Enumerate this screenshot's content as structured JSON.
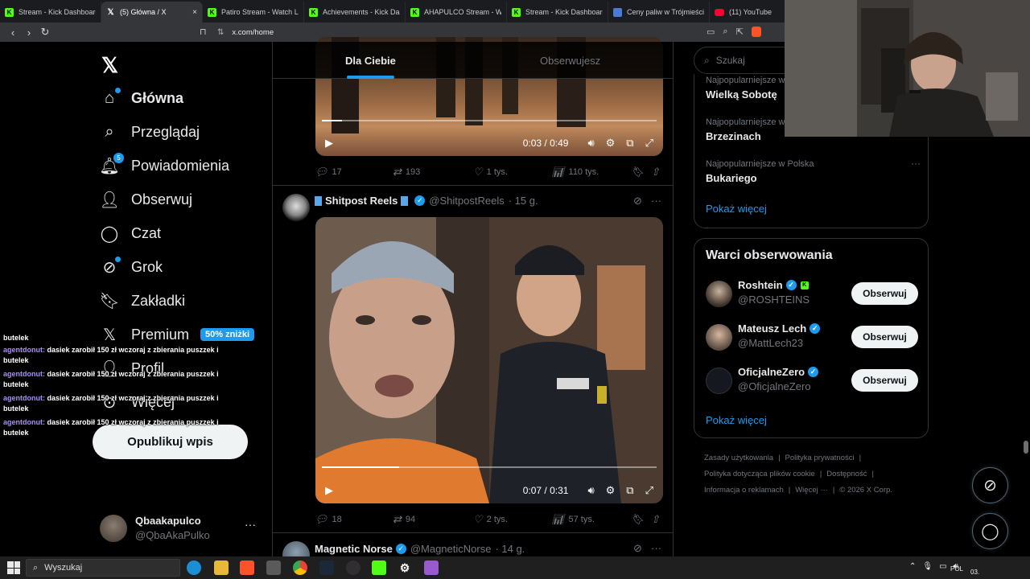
{
  "browser": {
    "tabs": [
      {
        "title": "Stream - Kick Dashboard",
        "icon": "kick-icon",
        "active": false
      },
      {
        "title": "(5) Główna / X",
        "icon": "x-icon",
        "active": true
      },
      {
        "title": "Patiro Stream - Watch Live",
        "icon": "kick-icon",
        "active": false
      },
      {
        "title": "Achievements - Kick Dash",
        "icon": "kick-icon",
        "active": false
      },
      {
        "title": "AHAPULCO Stream - Watc",
        "icon": "kick-icon",
        "active": false
      },
      {
        "title": "Stream - Kick Dashboard",
        "icon": "kick-icon",
        "active": false
      },
      {
        "title": "Ceny paliw w Trójmieście",
        "icon": "page-icon",
        "active": false
      },
      {
        "title": "(11) YouTube",
        "icon": "youtube-icon",
        "active": false
      }
    ],
    "tab_close": "×",
    "url": "x.com/home",
    "nav": {
      "back": "‹",
      "forward": "›",
      "reload": "↻"
    },
    "tune_glyph": "⇅",
    "bookmark_glyph": "⊓"
  },
  "sidebar": {
    "logo": "𝕏",
    "items": [
      {
        "label": "Główna",
        "icon": "home-icon",
        "glyph": "⌂",
        "active": true
      },
      {
        "label": "Przeglądaj",
        "icon": "search-icon",
        "glyph": "⌕"
      },
      {
        "label": "Powiadomienia",
        "icon": "bell-icon",
        "glyph": "🔔︎",
        "badge": "5"
      },
      {
        "label": "Obserwuj",
        "icon": "follow-icon",
        "glyph": "👤︎"
      },
      {
        "label": "Czat",
        "icon": "chat-icon",
        "glyph": "◯"
      },
      {
        "label": "Grok",
        "icon": "grok-icon",
        "glyph": "⊘"
      },
      {
        "label": "Zakładki",
        "icon": "bookmark-icon",
        "glyph": "🔖︎"
      },
      {
        "label": "Premium",
        "icon": "x-premium-icon",
        "glyph": "𝕏",
        "promo": "50% zniżki"
      },
      {
        "label": "Profil",
        "icon": "profile-icon",
        "glyph": "👤︎"
      },
      {
        "label": "Więcej",
        "icon": "more-icon",
        "glyph": "⊙"
      }
    ],
    "post_button": "Opublikuj wpis",
    "account": {
      "name": "Qbaakapulco",
      "handle": "@QbaAkaPulko",
      "more": "···"
    }
  },
  "chat_overlay": {
    "top_fragment": "butelek",
    "messages": [
      {
        "user": "agentdonut:",
        "text": "dasiek zarobił 150 zł wczoraj z zbierania puszzek i butelek"
      },
      {
        "user": "agentdonut:",
        "text": "dasiek zarobił 150 zł wczoraj z zbierania puszzek i butelek"
      },
      {
        "user": "agentdonut:",
        "text": "dasiek zarobił 150 zł wczoraj z zbierania puszzek i butelek"
      },
      {
        "user": "agentdonut:",
        "text": "dasiek zarobił 150 zł wczoraj z zbierania puszzek i butelek"
      }
    ]
  },
  "feed": {
    "tabs": {
      "for_you": "Dla Ciebie",
      "following": "Obserwujesz"
    },
    "tweets": [
      {
        "video": {
          "time": "0:03 / 0:49",
          "progress": 0.06
        },
        "stats": {
          "replies": "17",
          "reposts": "193",
          "likes": "1 tys.",
          "views": "110 tys."
        }
      },
      {
        "author": "Shitpost Reels",
        "handle": "@ShitpostReels",
        "age": "· 15 g.",
        "verified": "✓",
        "video": {
          "time": "0:07 / 0:31",
          "progress": 0.23
        },
        "stats": {
          "replies": "18",
          "reposts": "94",
          "likes": "2 tys.",
          "views": "57 tys."
        }
      },
      {
        "author": "Magnetic Norse",
        "handle": "@MagneticNorse",
        "age": "· 14 g.",
        "verified": "✓"
      }
    ],
    "glyphs": {
      "play": "▶",
      "volume": "🔊︎",
      "settings": "⚙",
      "pip": "⧉",
      "fullscreen": "⤢",
      "reply": "💬︎",
      "repost": "⇄",
      "like": "♡",
      "views": "📊︎",
      "bookmark": "🔖︎",
      "share": "⇧",
      "grok": "⊘",
      "more": "···"
    }
  },
  "right": {
    "search_placeholder": "Szukaj",
    "trends": [
      {
        "context": "Najpopularniejsze w",
        "title": "Wielką Sobotę"
      },
      {
        "context": "Najpopularniejsze w",
        "title": "Brzezinach"
      },
      {
        "context": "Najpopularniejsze w Polska",
        "title": "Bukariego"
      }
    ],
    "show_more": "Pokaż więcej",
    "who_to_follow": {
      "title": "Warci obserwowania",
      "follow_label": "Obserwuj",
      "accounts": [
        {
          "name": "Roshtein",
          "handle": "@ROSHTEINS",
          "kick": "K"
        },
        {
          "name": "Mateusz Lech",
          "handle": "@MattLech23"
        },
        {
          "name": "OficjalneZero",
          "handle": "@OficjalneZero"
        }
      ],
      "show_more": "Pokaż więcej"
    },
    "footer": {
      "links": [
        "Zasady użytkowania",
        "|",
        "Polityka prywatności",
        "|",
        "Polityka dotycząca plików cookie",
        "|",
        "Dostępność",
        "|",
        "Informacja o reklamach",
        "|",
        "Więcej ···",
        "|",
        "© 2026 X Corp."
      ]
    }
  },
  "taskbar": {
    "search": "Wyszukaj",
    "lang": "POL",
    "date": "03.",
    "apps": [
      "edge-icon",
      "files-icon",
      "brave-icon",
      "task-icon",
      "chrome-icon",
      "steam-icon",
      "obs-icon",
      "kick-icon",
      "settings-icon",
      "app-icon"
    ]
  },
  "colors": {
    "accent": "#1d9bf0",
    "background": "#000000",
    "kick": "#53fc18",
    "chat_user": "#a98cff"
  }
}
